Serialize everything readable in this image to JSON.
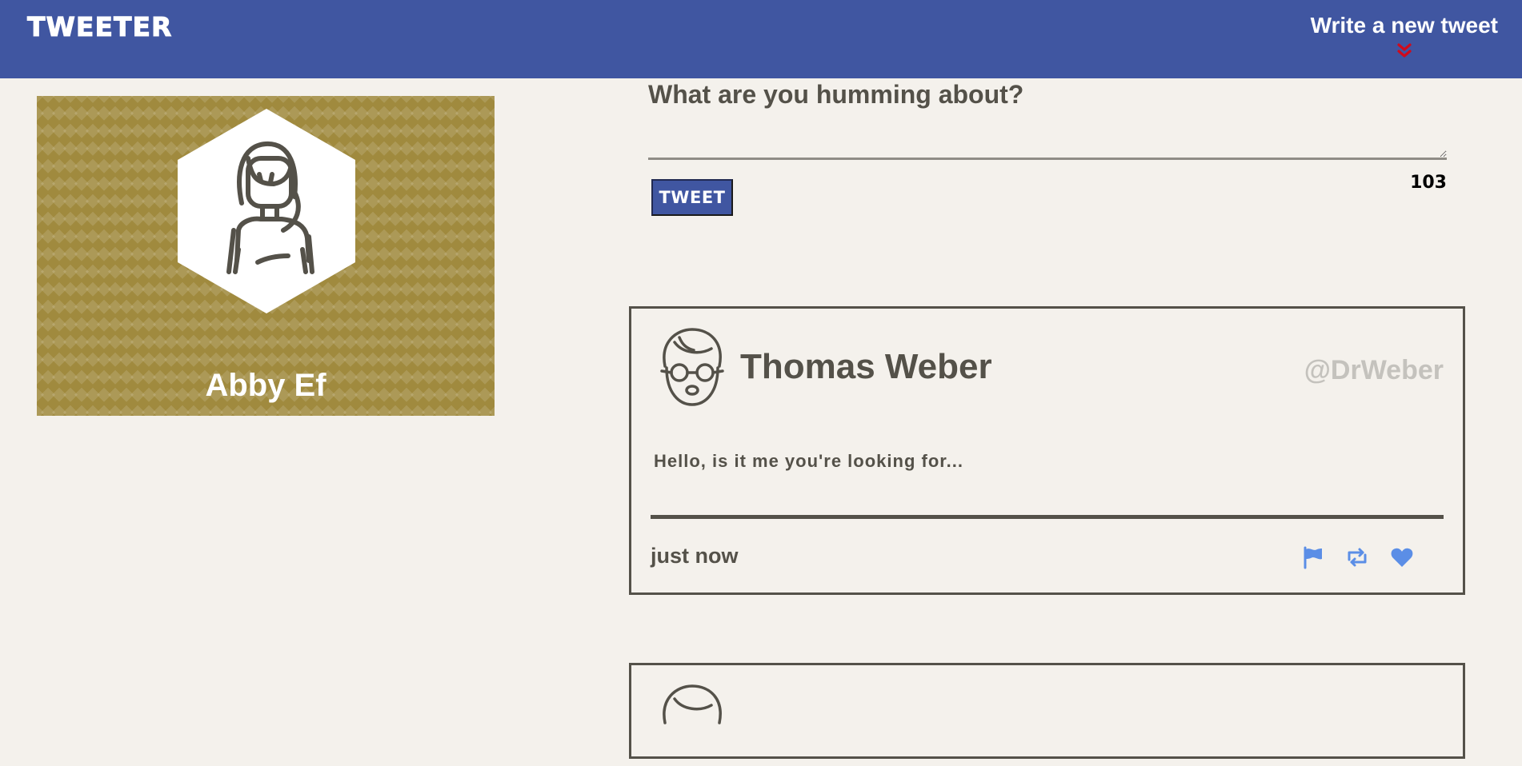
{
  "nav": {
    "brand": "TWEETER",
    "compose_toggle_label": "Write a new tweet",
    "toggle_icon": "double-chevron-down-icon",
    "toggle_icon_color": "#d10a1b"
  },
  "profile": {
    "name": "Abby Ef",
    "avatar_icon": "woman-avatar-icon",
    "background_color": "#a08a3e"
  },
  "compose": {
    "title": "What are you humming about?",
    "textarea_value": "",
    "tweet_button_label": "TWEET",
    "char_counter": "103"
  },
  "tweets": [
    {
      "author": "Thomas Weber",
      "handle": "@DrWeber",
      "avatar_icon": "man-with-glasses-avatar-icon",
      "body": "Hello, is it me you're looking for...",
      "time": "just now",
      "actions": [
        {
          "name": "flag-icon"
        },
        {
          "name": "retweet-icon"
        },
        {
          "name": "heart-icon"
        }
      ]
    }
  ],
  "colors": {
    "accent": "#4056a1",
    "action_icon": "#5b8ee6",
    "text": "#545149",
    "background": "#f4f1ec"
  }
}
